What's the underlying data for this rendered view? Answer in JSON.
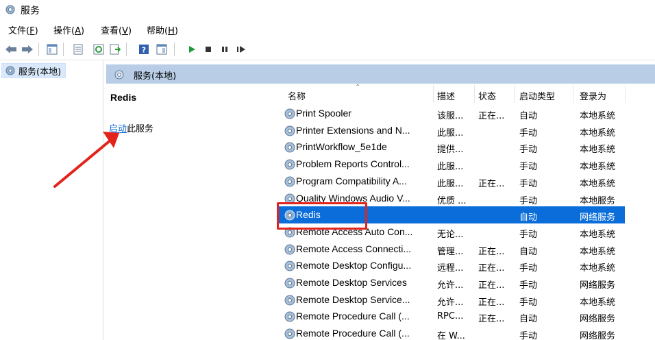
{
  "window": {
    "title": "服务"
  },
  "menu": [
    {
      "label": "文件(",
      "key": "F",
      "close": ")"
    },
    {
      "label": "操作(",
      "key": "A",
      "close": ")"
    },
    {
      "label": "查看(",
      "key": "V",
      "close": ")"
    },
    {
      "label": "帮助(",
      "key": "H",
      "close": ")"
    }
  ],
  "tree": {
    "item": "服务(本地)"
  },
  "panel": {
    "title": "服务(本地)"
  },
  "description": {
    "service_name": "Redis",
    "action_link": "启动",
    "action_rest": "此服务"
  },
  "columns": {
    "name": "名称",
    "desc": "描述",
    "status": "状态",
    "startup": "启动类型",
    "logon": "登录为"
  },
  "services": [
    {
      "name": "Print Spooler",
      "desc": "该服...",
      "status": "正在...",
      "startup": "自动",
      "logon": "本地系统"
    },
    {
      "name": "Printer Extensions and N...",
      "desc": "此服...",
      "status": "",
      "startup": "手动",
      "logon": "本地系统"
    },
    {
      "name": "PrintWorkflow_5e1de",
      "desc": "提供...",
      "status": "",
      "startup": "手动",
      "logon": "本地系统"
    },
    {
      "name": "Problem Reports Control...",
      "desc": "此服...",
      "status": "",
      "startup": "手动",
      "logon": "本地系统"
    },
    {
      "name": "Program Compatibility A...",
      "desc": "此服...",
      "status": "正在...",
      "startup": "手动",
      "logon": "本地系统"
    },
    {
      "name": "Quality Windows Audio V...",
      "desc": "优质 ...",
      "status": "",
      "startup": "手动",
      "logon": "本地服务"
    },
    {
      "name": "Redis",
      "desc": "",
      "status": "",
      "startup": "自动",
      "logon": "网络服务",
      "selected": true
    },
    {
      "name": "Remote Access Auto Con...",
      "desc": "无论...",
      "status": "",
      "startup": "手动",
      "logon": "本地系统"
    },
    {
      "name": "Remote Access Connecti...",
      "desc": "管理...",
      "status": "正在...",
      "startup": "自动",
      "logon": "本地系统"
    },
    {
      "name": "Remote Desktop Configu...",
      "desc": "远程...",
      "status": "正在...",
      "startup": "手动",
      "logon": "本地系统"
    },
    {
      "name": "Remote Desktop Services",
      "desc": "允许...",
      "status": "正在...",
      "startup": "手动",
      "logon": "网络服务"
    },
    {
      "name": "Remote Desktop Service...",
      "desc": "允许...",
      "status": "正在...",
      "startup": "手动",
      "logon": "本地系统"
    },
    {
      "name": "Remote Procedure Call (...",
      "desc": "RPC...",
      "status": "正在...",
      "startup": "自动",
      "logon": "网络服务"
    },
    {
      "name": "Remote Procedure Call (...",
      "desc": "在 W...",
      "status": "",
      "startup": "手动",
      "logon": "网络服务"
    }
  ],
  "colors": {
    "selection": "#0a6dd9",
    "panel_header": "#b9cee6",
    "annotation": "#e3231b",
    "link": "#1a6fd6"
  }
}
